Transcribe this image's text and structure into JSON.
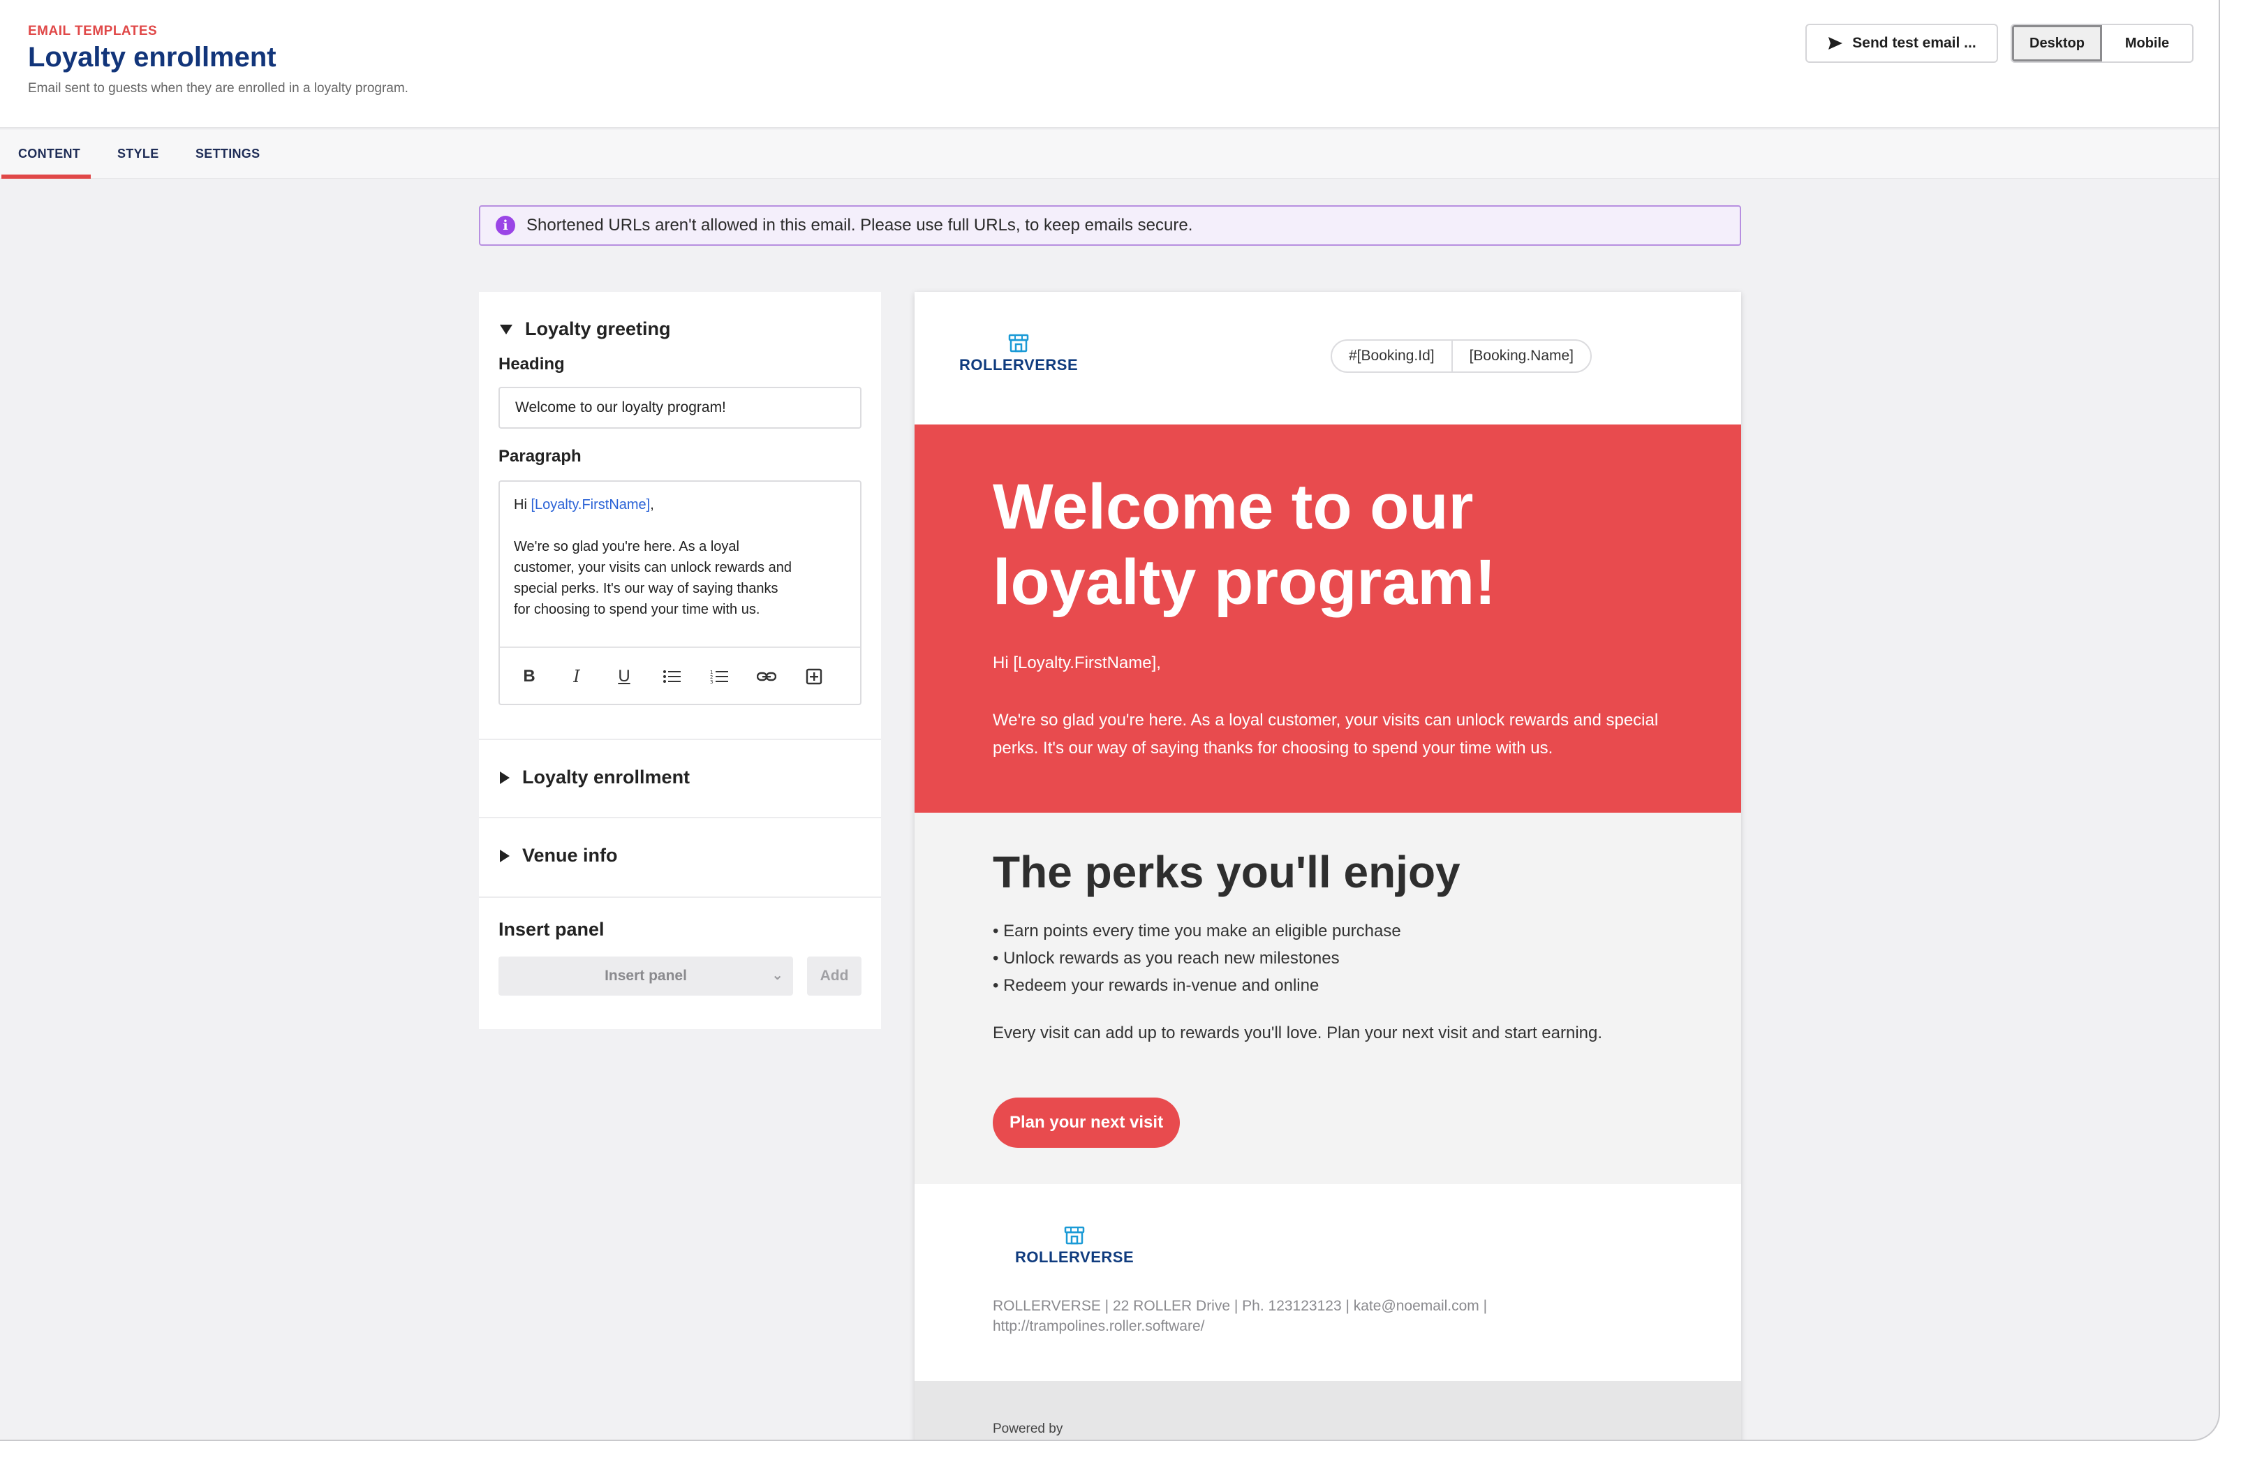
{
  "header": {
    "eyebrow": "EMAIL TEMPLATES",
    "title": "Loyalty enrollment",
    "subtitle": "Email sent to guests when they are enrolled in a loyalty program.",
    "send_test_label": "Send test email ...",
    "view_toggle": {
      "desktop": "Desktop",
      "mobile": "Mobile",
      "selected": "Desktop"
    }
  },
  "tabs": [
    {
      "label": "CONTENT",
      "active": true
    },
    {
      "label": "STYLE",
      "active": false
    },
    {
      "label": "SETTINGS",
      "active": false
    }
  ],
  "notice": {
    "text": "Shortened URLs aren't allowed in this email. Please use full URLs, to keep emails secure."
  },
  "editor": {
    "greeting_section": "Loyalty greeting",
    "heading_label": "Heading",
    "heading_value": "Welcome to our loyalty program!",
    "paragraph_label": "Paragraph",
    "paragraph": {
      "greeting_prefix": "Hi ",
      "token": "[Loyalty.FirstName]",
      "greeting_suffix": ",",
      "lines": [
        "We're so glad you're here. As a loyal",
        "customer, your visits can unlock rewards and",
        "special perks. It's our way of saying thanks",
        "for choosing to spend your time with us."
      ]
    },
    "toolbar": {
      "bold": "B",
      "italic": "I",
      "underline": "U"
    },
    "enrollment_section": "Loyalty enrollment",
    "venue_section": "Venue info",
    "insert_panel_label": "Insert panel",
    "insert_panel_placeholder": "Insert panel",
    "add_label": "Add"
  },
  "preview": {
    "brand": "ROLLERVERSE",
    "tokens": [
      "#[Booking.Id]",
      "[Booking.Name]"
    ],
    "hero_heading": "Welcome to our loyalty program!",
    "hero_hi": "Hi [Loyalty.FirstName],",
    "hero_body": "We're so glad you're here. As a loyal customer, your visits can unlock rewards and special perks. It's our way of saying thanks for choosing to spend your time with us.",
    "perks_heading": "The perks you'll enjoy",
    "perks": [
      "• Earn points every time you make an eligible purchase",
      "• Unlock rewards as you reach new milestones",
      "• Redeem your rewards in-venue and online"
    ],
    "perks_follow": "Every visit can add up to rewards you'll love. Plan your next visit and start earning.",
    "cta_label": "Plan your next visit",
    "footer_address": "ROLLERVERSE | 22 ROLLER Drive | Ph. 123123123 | kate@noemail.com | http://trampolines.roller.software/",
    "powered_by": "Powered by"
  },
  "colors": {
    "accent_red": "#e84b4e",
    "title_navy": "#12357a",
    "notice_purple": "#9a45e6"
  }
}
